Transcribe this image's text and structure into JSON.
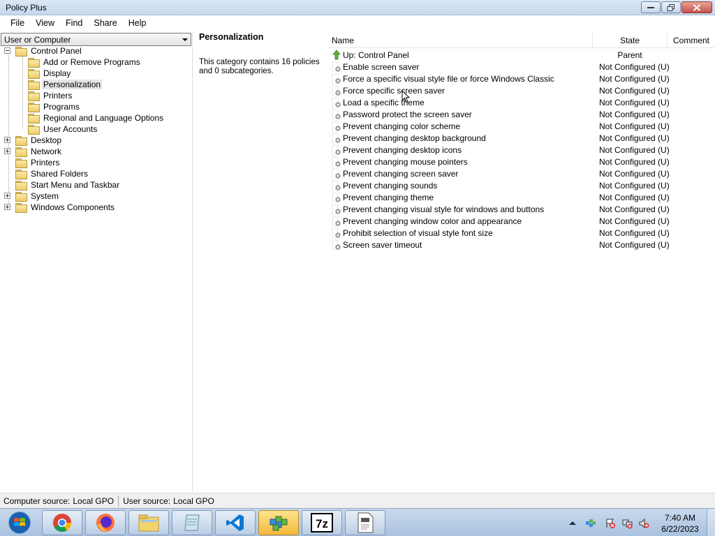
{
  "window": {
    "title": "Policy Plus"
  },
  "menu": [
    "File",
    "View",
    "Find",
    "Share",
    "Help"
  ],
  "left": {
    "combo_value": "User or Computer",
    "tree": [
      {
        "label": "Control Panel",
        "level": 0,
        "expander": "minus"
      },
      {
        "label": "Add or Remove Programs",
        "level": 1
      },
      {
        "label": "Display",
        "level": 1
      },
      {
        "label": "Personalization",
        "level": 1,
        "selected": true
      },
      {
        "label": "Printers",
        "level": 1
      },
      {
        "label": "Programs",
        "level": 1
      },
      {
        "label": "Regional and Language Options",
        "level": 1
      },
      {
        "label": "User Accounts",
        "level": 1
      },
      {
        "label": "Desktop",
        "level": 0,
        "expander": "plus"
      },
      {
        "label": "Network",
        "level": 0,
        "expander": "plus"
      },
      {
        "label": "Printers",
        "level": 0
      },
      {
        "label": "Shared Folders",
        "level": 0
      },
      {
        "label": "Start Menu and Taskbar",
        "level": 0
      },
      {
        "label": "System",
        "level": 0,
        "expander": "plus"
      },
      {
        "label": "Windows Components",
        "level": 0,
        "expander": "plus"
      }
    ]
  },
  "middle": {
    "heading": "Personalization",
    "description": "This category contains 16 policies and 0 subcategories."
  },
  "list": {
    "columns": {
      "name": "Name",
      "state": "State",
      "comment": "Comment"
    },
    "up_row": {
      "name": "Up: Control Panel",
      "state": "Parent"
    },
    "rows": [
      {
        "name": "Enable screen saver",
        "state": "Not Configured (U)"
      },
      {
        "name": "Force a specific visual style file or force Windows Classic",
        "state": "Not Configured (U)"
      },
      {
        "name": "Force specific screen saver",
        "state": "Not Configured (U)"
      },
      {
        "name": "Load a specific theme",
        "state": "Not Configured (U)"
      },
      {
        "name": "Password protect the screen saver",
        "state": "Not Configured (U)"
      },
      {
        "name": "Prevent changing color scheme",
        "state": "Not Configured (U)"
      },
      {
        "name": "Prevent changing desktop background",
        "state": "Not Configured (U)"
      },
      {
        "name": "Prevent changing desktop icons",
        "state": "Not Configured (U)"
      },
      {
        "name": "Prevent changing mouse pointers",
        "state": "Not Configured (U)"
      },
      {
        "name": "Prevent changing screen saver",
        "state": "Not Configured (U)"
      },
      {
        "name": "Prevent changing sounds",
        "state": "Not Configured (U)"
      },
      {
        "name": "Prevent changing theme",
        "state": "Not Configured (U)"
      },
      {
        "name": "Prevent changing visual style for windows and buttons",
        "state": "Not Configured (U)"
      },
      {
        "name": "Prevent changing window color and appearance",
        "state": "Not Configured (U)"
      },
      {
        "name": "Prohibit selection of visual style font size",
        "state": "Not Configured (U)"
      },
      {
        "name": "Screen saver timeout",
        "state": "Not Configured (U)"
      }
    ]
  },
  "status": {
    "computer_label": "Computer source:",
    "computer_value": "Local GPO",
    "user_label": "User source:",
    "user_value": "Local GPO"
  },
  "taskbar": {
    "apps": [
      "chrome-icon",
      "firefox-icon",
      "file-explorer-icon",
      "notepad-icon",
      "vscode-icon",
      "policy-plus-icon",
      "7zip-icon",
      "document-icon"
    ],
    "active_app": "policy-plus-icon",
    "time": "7:40 AM",
    "date": "6/22/2023"
  }
}
